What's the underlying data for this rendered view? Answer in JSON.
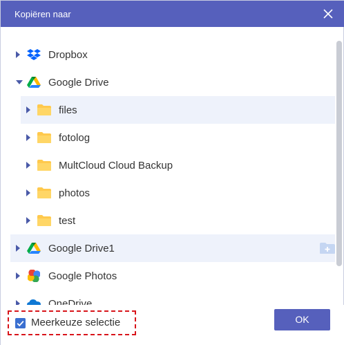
{
  "dialog": {
    "title": "Kopiëren naar",
    "accent_color": "#5660bc"
  },
  "tree": {
    "items": [
      {
        "label": "Dropbox",
        "icon": "dropbox-icon",
        "expanded": false
      },
      {
        "label": "Google Drive",
        "icon": "google-drive-icon",
        "expanded": true,
        "children": [
          {
            "label": "files",
            "icon": "folder-icon",
            "selected": true
          },
          {
            "label": "fotolog",
            "icon": "folder-icon"
          },
          {
            "label": "MultCloud Cloud Backup",
            "icon": "folder-icon"
          },
          {
            "label": "photos",
            "icon": "folder-icon"
          },
          {
            "label": "test",
            "icon": "folder-icon"
          }
        ]
      },
      {
        "label": "Google Drive1",
        "icon": "google-drive-icon",
        "expanded": false,
        "hovered": true
      },
      {
        "label": "Google Photos",
        "icon": "google-photos-icon",
        "expanded": false
      },
      {
        "label": "OneDrive",
        "icon": "onedrive-icon",
        "expanded": false
      }
    ]
  },
  "footer": {
    "multiselect_label": "Meerkeuze selectie",
    "multiselect_checked": true,
    "ok_label": "OK"
  }
}
